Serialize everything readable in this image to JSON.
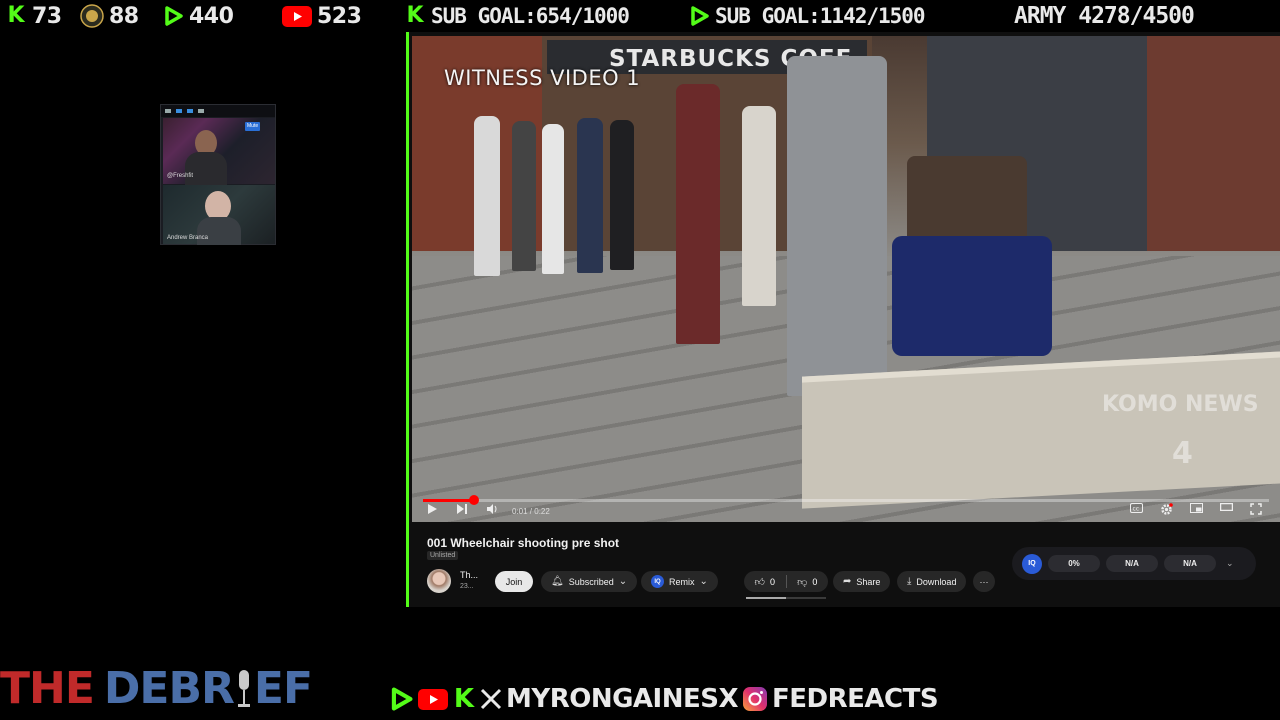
{
  "overlay": {
    "kick_count": "73",
    "medal_count": "88",
    "rumble_count": "440",
    "youtube_count": "523",
    "kick_sub_goal": "SUB GOAL:654/1000",
    "rumble_sub_goal": "SUB GOAL:1142/1500",
    "army": "ARMY 4278/4500",
    "show_title_part1": "THE",
    "show_title_part2": "DEBR",
    "show_title_part3": "EF",
    "handle_1": "MYRONGAINESX",
    "handle_2": "FEDREACTS",
    "colors": {
      "kick_green": "#53fc18",
      "youtube_red": "#ff0000",
      "debrief_red": "#c02a2a",
      "debrief_blue": "#4a6ea8"
    }
  },
  "webcams": {
    "host_name": "@Freshfit",
    "guest_name": "Andrew Branca",
    "mute_label": "Mute"
  },
  "video": {
    "overlay_text": "WITNESS VIDEO 1",
    "sign_text": "STARBUCKS COFF",
    "watermark": "KOMO NEWS",
    "watermark_num": "4",
    "progress": 0.06,
    "time": "0:01 / 0:22"
  },
  "details": {
    "title": "001 Wheelchair shooting pre shot",
    "visibility": "Unlisted",
    "channel_name": "Th...",
    "channel_sub": "23...",
    "join_label": "Join",
    "subscribed_label": "Subscribed",
    "remix_label": "Remix",
    "likes": "0",
    "dislikes": "0",
    "share_label": "Share",
    "download_label": "Download",
    "more_label": "···"
  },
  "iq_panel": {
    "badge": "IQ",
    "percent": "0%",
    "cell2": "N/A",
    "cell3": "N/A"
  }
}
